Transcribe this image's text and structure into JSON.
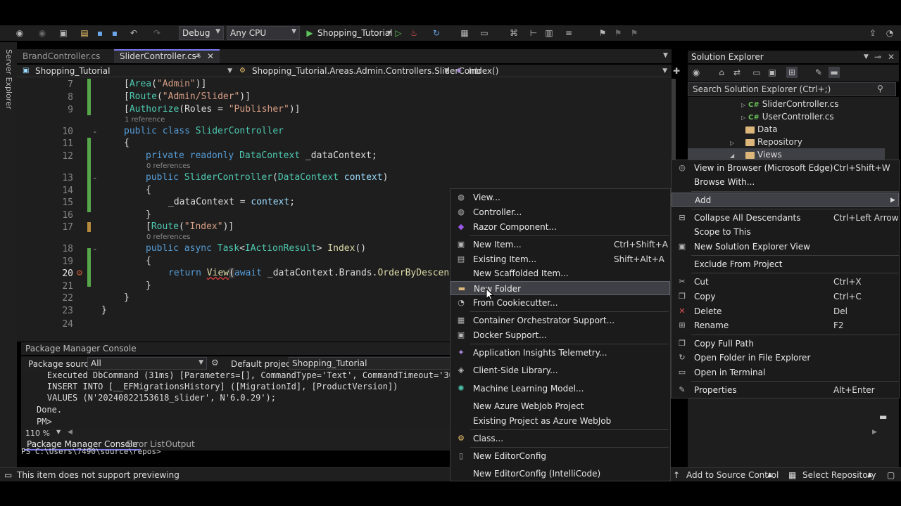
{
  "toolbar": {
    "config": "Debug",
    "platform": "Any CPU",
    "run_target": "Shopping_Tutorial"
  },
  "left_strip": {
    "server_explorer": "Server Explorer"
  },
  "doc_tabs": [
    {
      "label": "BrandController.cs"
    },
    {
      "label": "SliderController.cs*"
    }
  ],
  "navbar": {
    "project": "Shopping_Tutorial",
    "class": "Shopping_Tutorial.Areas.Admin.Controllers.SliderContr",
    "member": "Index()"
  },
  "editor": {
    "line_numbers": [
      "7",
      "8",
      "9",
      "10",
      "11",
      "12",
      "13",
      "14",
      "15",
      "16",
      "17",
      "18",
      "19",
      "20",
      "21",
      "22",
      "23",
      "24"
    ],
    "ref_1": "1 reference",
    "ref_0a": "0 references",
    "ref_0b": "0 references",
    "l7a": "[",
    "l7b": "Area",
    "l7c": "(",
    "l7d": "\"Admin\"",
    "l7e": ")]",
    "l8a": "[",
    "l8b": "Route",
    "l8c": "(",
    "l8d": "\"Admin/Slider\"",
    "l8e": ")]",
    "l9a": "[",
    "l9b": "Authorize",
    "l9c": "(Roles = ",
    "l9d": "\"Publisher\"",
    "l9e": ")]",
    "l10a": "public class ",
    "l10b": "SliderController",
    "l11": "{",
    "l12a": "private readonly ",
    "l12b": "DataContext",
    "l12c": " _dataContext;",
    "l13a": "public ",
    "l13b": "SliderController",
    "l13c": "(",
    "l13d": "DataContext",
    "l13e": " context",
    "l13f": ")",
    "l14": "{",
    "l15a": "_dataContext = ",
    "l15b": "context",
    "l15c": ";",
    "l16": "}",
    "l17a": "[",
    "l17b": "Route",
    "l17c": "(",
    "l17d": "\"Index\"",
    "l17e": ")]",
    "l18a": "public async ",
    "l18b": "Task",
    "l18c": "<",
    "l18d": "IActionResult",
    "l18e": "> ",
    "l18f": "Index",
    "l18g": "()",
    "l19": "{",
    "l20a": "return ",
    "l20b": "View",
    "l20c": "(",
    "l20d": "await ",
    "l20e": "_dataContext.Brands.",
    "l20f": "OrderByDescen",
    "l21": "}",
    "l22": "}",
    "l23": "}"
  },
  "pmc": {
    "title": "Package Manager Console",
    "source_label": "Package source:",
    "source_value": "All",
    "default_project_label": "Default project:",
    "default_project_value": "Shopping_Tutorial",
    "output": [
      "    Executed DbCommand (31ms) [Parameters=[], CommandType='Text', CommandTimeout='30",
      "    INSERT INTO [__EFMigrationsHistory] ([MigrationId], [ProductVersion])",
      "    VALUES (N'20240822153618_slider', N'6.0.29');",
      "Done.",
      "PM>"
    ],
    "zoom": "110 %",
    "tabs": [
      "Package Manager Console",
      "Error List",
      "Output"
    ],
    "ghost_prompt": "PS C:\\Users\\7490\\source\\repos>"
  },
  "status": {
    "message": "This item does not support previewing",
    "source_control": "Add to Source Control",
    "repository": "Select Repository"
  },
  "solution_explorer": {
    "title": "Solution Explorer",
    "search_placeholder": "Search Solution Explorer (Ctrl+;)",
    "tree": [
      {
        "label": "SliderController.cs",
        "type": "cs"
      },
      {
        "label": "UserController.cs",
        "type": "cs"
      },
      {
        "label": "Data",
        "type": "folder"
      },
      {
        "label": "Repository",
        "type": "folder"
      },
      {
        "label": "Views",
        "type": "folder"
      }
    ]
  },
  "main_menu": [
    {
      "label": "View in Browser (Microsoft Edge)",
      "shortcut": "Ctrl+Shift+W",
      "icon": "browser-icon"
    },
    {
      "label": "Browse With...",
      "shortcut": "",
      "icon": ""
    },
    {
      "label": "Add",
      "shortcut": "",
      "icon": ""
    },
    {
      "label": "Collapse All Descendants",
      "shortcut": "Ctrl+Left Arrow",
      "icon": "collapse-icon"
    },
    {
      "label": "Scope to This",
      "shortcut": "",
      "icon": ""
    },
    {
      "label": "New Solution Explorer View",
      "shortcut": "",
      "icon": "new-view-icon"
    },
    {
      "label": "Exclude From Project",
      "shortcut": "",
      "icon": ""
    },
    {
      "label": "Cut",
      "shortcut": "Ctrl+X",
      "icon": "cut-icon"
    },
    {
      "label": "Copy",
      "shortcut": "Ctrl+C",
      "icon": "copy-icon"
    },
    {
      "label": "Delete",
      "shortcut": "Del",
      "icon": "delete-icon"
    },
    {
      "label": "Rename",
      "shortcut": "F2",
      "icon": "rename-icon"
    },
    {
      "label": "Copy Full Path",
      "shortcut": "",
      "icon": "copy-path-icon"
    },
    {
      "label": "Open Folder in File Explorer",
      "shortcut": "",
      "icon": "open-folder-icon"
    },
    {
      "label": "Open in Terminal",
      "shortcut": "",
      "icon": "terminal-icon"
    },
    {
      "label": "Properties",
      "shortcut": "Alt+Enter",
      "icon": "wrench-icon"
    }
  ],
  "add_menu": [
    {
      "label": "View...",
      "shortcut": "",
      "icon": "view-icon"
    },
    {
      "label": "Controller...",
      "shortcut": "",
      "icon": "controller-icon"
    },
    {
      "label": "Razor Component...",
      "shortcut": "",
      "icon": "razor-icon"
    },
    {
      "label": "New Item...",
      "shortcut": "Ctrl+Shift+A",
      "icon": "new-item-icon"
    },
    {
      "label": "Existing Item...",
      "shortcut": "Shift+Alt+A",
      "icon": "existing-item-icon"
    },
    {
      "label": "New Scaffolded Item...",
      "shortcut": "",
      "icon": ""
    },
    {
      "label": "New Folder",
      "shortcut": "",
      "icon": "folder-icon"
    },
    {
      "label": "From Cookiecutter...",
      "shortcut": "",
      "icon": "cookiecutter-icon"
    },
    {
      "label": "Container Orchestrator Support...",
      "shortcut": "",
      "icon": "container-icon"
    },
    {
      "label": "Docker Support...",
      "shortcut": "",
      "icon": "docker-icon"
    },
    {
      "label": "Application Insights Telemetry...",
      "shortcut": "",
      "icon": "insights-icon"
    },
    {
      "label": "Client-Side Library...",
      "shortcut": "",
      "icon": "library-icon"
    },
    {
      "label": "Machine Learning Model...",
      "shortcut": "",
      "icon": "ml-icon"
    },
    {
      "label": "New Azure WebJob Project",
      "shortcut": "",
      "icon": ""
    },
    {
      "label": "Existing Project as Azure WebJob",
      "shortcut": "",
      "icon": ""
    },
    {
      "label": "Class...",
      "shortcut": "",
      "icon": "class-icon"
    },
    {
      "label": "New EditorConfig",
      "shortcut": "",
      "icon": "editorconfig-icon"
    },
    {
      "label": "New EditorConfig (IntelliCode)",
      "shortcut": "",
      "icon": ""
    }
  ]
}
